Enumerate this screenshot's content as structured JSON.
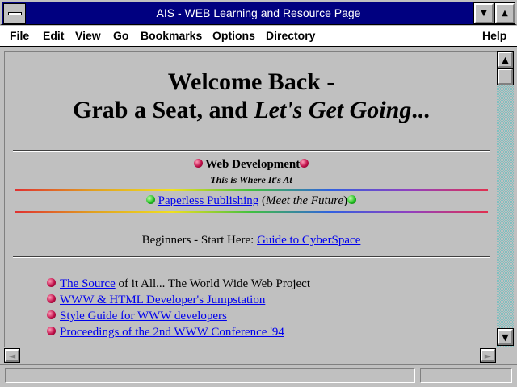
{
  "window": {
    "title": "AIS - WEB Learning and Resource Page",
    "minimize_glyph": "▼",
    "maximize_glyph": "▲"
  },
  "menu": {
    "file": "File",
    "edit": "Edit",
    "view": "View",
    "go": "Go",
    "bookmarks": "Bookmarks",
    "options": "Options",
    "directory": "Directory",
    "help": "Help"
  },
  "page": {
    "heading_line1": "Welcome Back -",
    "heading_line2_pre": "Grab a Seat, and ",
    "heading_line2_italic": "Let's Get Going",
    "heading_line2_post": "...",
    "webdev_title": "Web Development",
    "webdev_subtitle": "This is Where It's At",
    "paperless_link": "Paperless Publishing",
    "paperless_open": " (",
    "paperless_note": "Meet the Future",
    "paperless_close": ")",
    "beginners_text": "Beginners - Start Here: ",
    "beginners_link": "Guide to CyberSpace",
    "list": [
      {
        "link": "The Source",
        "text": " of it All... The World Wide Web Project"
      },
      {
        "link": "WWW & HTML Developer's Jumpstation",
        "text": ""
      },
      {
        "link": "Style Guide for WWW developers",
        "text": ""
      },
      {
        "link": "Proceedings of the 2nd WWW Conference '94",
        "text": ""
      }
    ]
  },
  "scroll": {
    "up_glyph": "▲",
    "down_glyph": "▼",
    "left_glyph": "◄",
    "right_glyph": "►"
  },
  "icons": {
    "webdev_bullet": "red-ball-icon",
    "paperless_bullet": "green-ball-icon",
    "list_bullet": "red-ball-icon"
  }
}
